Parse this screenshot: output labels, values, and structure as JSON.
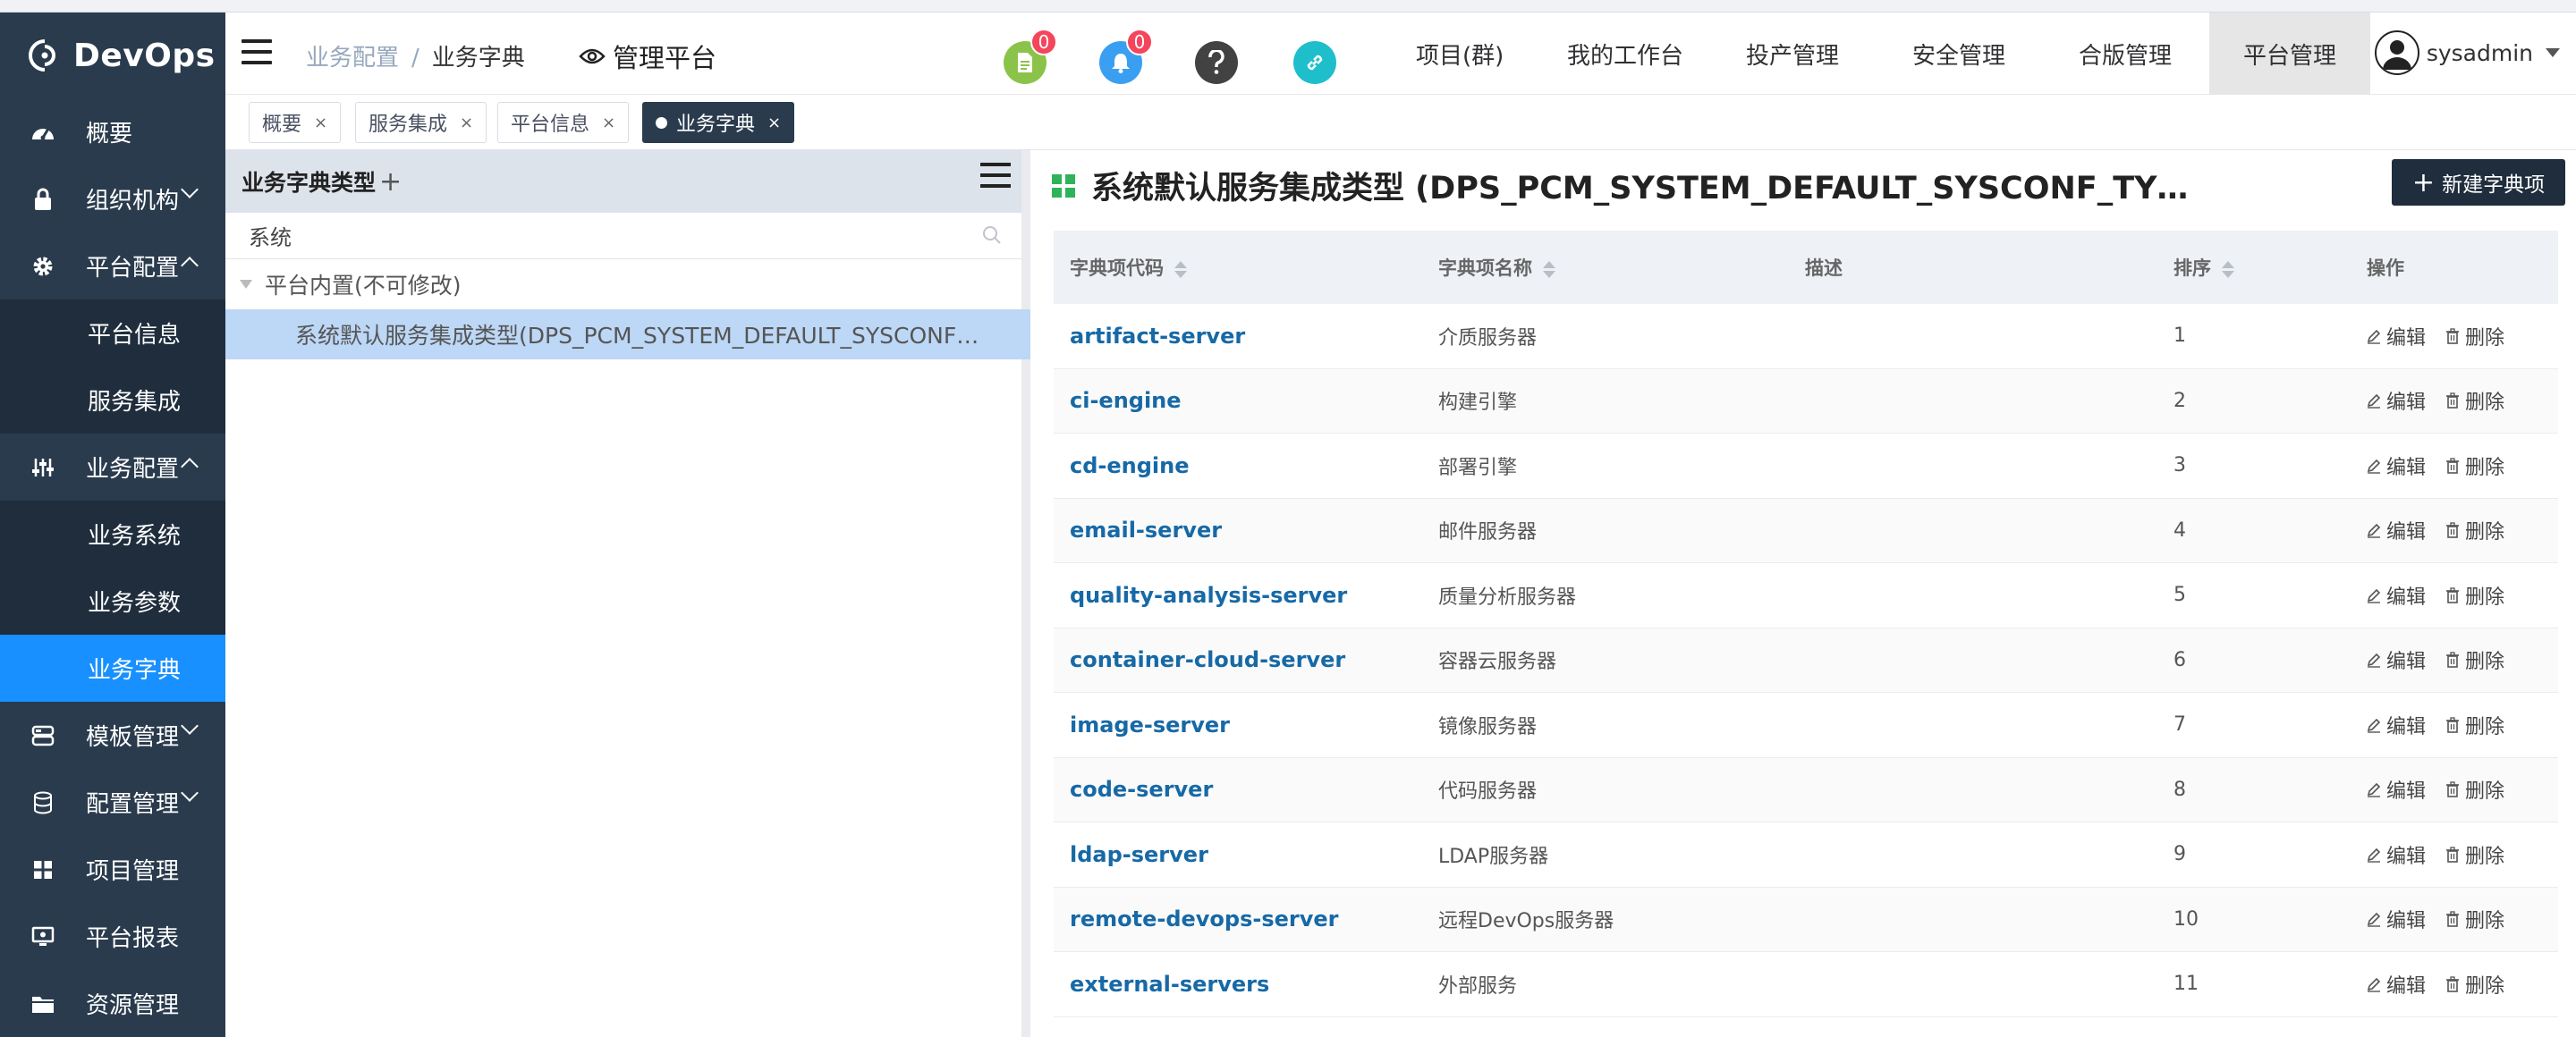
{
  "app": {
    "logo_text": "DevOps"
  },
  "sidebar": {
    "items": [
      {
        "label": "概要"
      },
      {
        "label": "组织机构"
      },
      {
        "label": "平台配置"
      },
      {
        "label": "平台信息"
      },
      {
        "label": "服务集成"
      },
      {
        "label": "业务配置"
      },
      {
        "label": "业务系统"
      },
      {
        "label": "业务参数"
      },
      {
        "label": "业务字典"
      },
      {
        "label": "模板管理"
      },
      {
        "label": "配置管理"
      },
      {
        "label": "项目管理"
      },
      {
        "label": "平台报表"
      },
      {
        "label": "资源管理"
      }
    ]
  },
  "header": {
    "breadcrumb": [
      "业务配置",
      "业务字典"
    ],
    "breadcrumb_sep": "/",
    "platform_label": "管理平台",
    "badge1": "0",
    "badge2": "0",
    "nav": [
      "项目(群)",
      "我的工作台",
      "投产管理",
      "安全管理",
      "合版管理",
      "平台管理"
    ],
    "username": "sysadmin"
  },
  "tabs": [
    {
      "label": "概要",
      "close": "×"
    },
    {
      "label": "服务集成",
      "close": "×"
    },
    {
      "label": "平台信息",
      "close": "×"
    },
    {
      "label": "业务字典",
      "close": "×"
    }
  ],
  "left": {
    "title": "业务字典类型",
    "add": "+",
    "search_value": "系统",
    "tree_group": "平台内置(不可修改)",
    "tree_leaf": "系统默认服务集成类型(DPS_PCM_SYSTEM_DEFAULT_SYSCONF…"
  },
  "right": {
    "title": "系统默认服务集成类型 (DPS_PCM_SYSTEM_DEFAULT_SYSCONF_TY…",
    "new_button": "新建字典项",
    "new_button_plus": "+",
    "columns": [
      "字典项代码",
      "字典项名称",
      "描述",
      "排序",
      "操作"
    ],
    "edit_label": "编辑",
    "delete_label": "删除",
    "rows": [
      {
        "code": "artifact-server",
        "name": "介质服务器",
        "desc": "",
        "order": "1"
      },
      {
        "code": "ci-engine",
        "name": "构建引擎",
        "desc": "",
        "order": "2"
      },
      {
        "code": "cd-engine",
        "name": "部署引擎",
        "desc": "",
        "order": "3"
      },
      {
        "code": "email-server",
        "name": "邮件服务器",
        "desc": "",
        "order": "4"
      },
      {
        "code": "quality-analysis-server",
        "name": "质量分析服务器",
        "desc": "",
        "order": "5"
      },
      {
        "code": "container-cloud-server",
        "name": "容器云服务器",
        "desc": "",
        "order": "6"
      },
      {
        "code": "image-server",
        "name": "镜像服务器",
        "desc": "",
        "order": "7"
      },
      {
        "code": "code-server",
        "name": "代码服务器",
        "desc": "",
        "order": "8"
      },
      {
        "code": "ldap-server",
        "name": "LDAP服务器",
        "desc": "",
        "order": "9"
      },
      {
        "code": "remote-devops-server",
        "name": "远程DevOps服务器",
        "desc": "",
        "order": "10"
      },
      {
        "code": "external-servers",
        "name": "外部服务",
        "desc": "",
        "order": "11"
      }
    ]
  }
}
